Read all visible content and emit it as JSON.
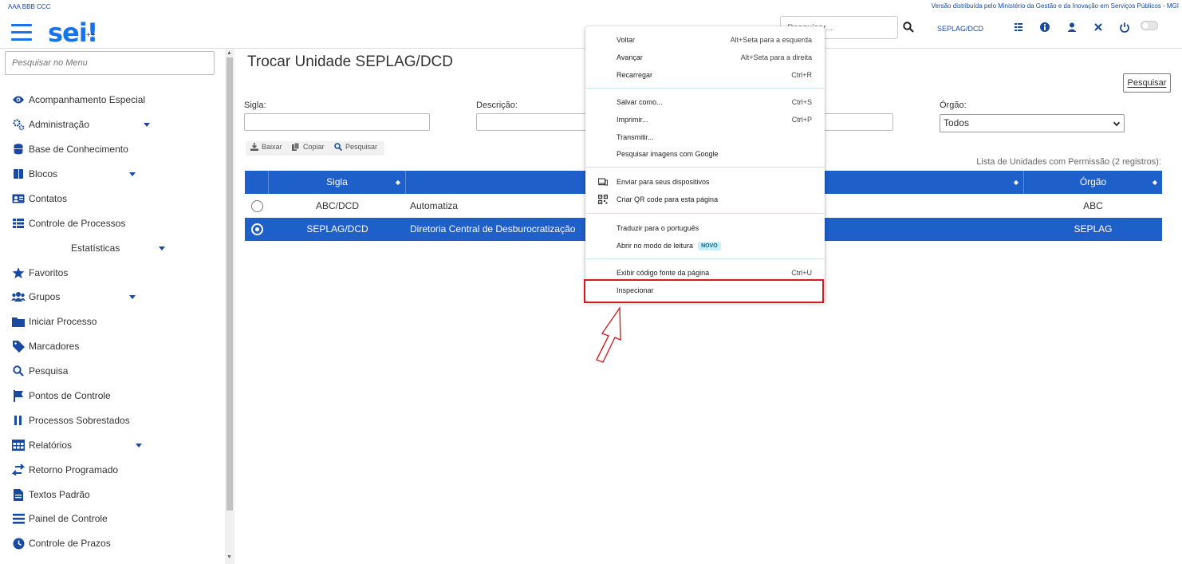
{
  "header": {
    "org": "AAA BBB CCC",
    "gov": "Versão distribuída pelo Ministério da Gestão e da Inovação em Serviços Públicos - MGI",
    "logo": "sei!",
    "logo_sub": "++",
    "search_placeholder": "Pesquisar...",
    "unit": "SEPLAG/DCD",
    "icons": [
      "grid-icon",
      "info-icon",
      "user-icon",
      "tools-icon",
      "power-icon",
      "theme-toggle"
    ]
  },
  "sidebar": {
    "search_placeholder": "Pesquisar no Menu",
    "items": [
      {
        "label": "Acompanhamento Especial",
        "icon": "eye-icon"
      },
      {
        "label": "Administração",
        "icon": "gears-icon",
        "expandable": true
      },
      {
        "label": "Base de Conhecimento",
        "icon": "database-icon"
      },
      {
        "label": "Blocos",
        "icon": "book-icon",
        "expandable": true
      },
      {
        "label": "Contatos",
        "icon": "contact-card-icon"
      },
      {
        "label": "Controle de Processos",
        "icon": "list-icon"
      },
      {
        "label": "Estatísticas",
        "icon": "",
        "expandable": true
      },
      {
        "label": "Favoritos",
        "icon": "star-icon"
      },
      {
        "label": "Grupos",
        "icon": "users-icon",
        "expandable": true
      },
      {
        "label": "Iniciar Processo",
        "icon": "folder-icon"
      },
      {
        "label": "Marcadores",
        "icon": "tag-icon"
      },
      {
        "label": "Pesquisa",
        "icon": "search-icon"
      },
      {
        "label": "Pontos de Controle",
        "icon": "flag-icon"
      },
      {
        "label": "Processos Sobrestados",
        "icon": "pause-icon"
      },
      {
        "label": "Relatórios",
        "icon": "table-icon",
        "expandable": true
      },
      {
        "label": "Retorno Programado",
        "icon": "exchange-icon"
      },
      {
        "label": "Textos Padrão",
        "icon": "file-icon"
      },
      {
        "label": "Painel de Controle",
        "icon": "bars-icon"
      },
      {
        "label": "Controle de Prazos",
        "icon": "clock-icon"
      }
    ]
  },
  "main": {
    "title": "Trocar Unidade SEPLAG/DCD",
    "search_button": "Pesquisar",
    "fields": {
      "sigla_label": "Sigla:",
      "descricao_label": "Descrição:",
      "orgao_label": "Órgão:",
      "orgao_value": "Todos"
    },
    "toolbar": {
      "baixar": "Baixar",
      "copiar": "Copiar",
      "pesquisar": "Pesquisar"
    },
    "list_caption": "Lista de Unidades com Permissão (2 registros):",
    "table": {
      "headers": [
        "Sigla",
        "",
        "Órgão"
      ],
      "rows": [
        {
          "sigla": "ABC/DCD",
          "descricao": "Automatiza",
          "orgao": "ABC",
          "selected": false
        },
        {
          "sigla": "SEPLAG/DCD",
          "descricao": "Diretoria Central de Desburocratização",
          "orgao": "SEPLAG",
          "selected": true
        }
      ]
    }
  },
  "context_menu": {
    "groups": [
      [
        {
          "label": "Voltar",
          "shortcut": "Alt+Seta para a esquerda"
        },
        {
          "label": "Avançar",
          "shortcut": "Alt+Seta para a direita"
        },
        {
          "label": "Recarregar",
          "shortcut": "Ctrl+R"
        }
      ],
      [
        {
          "label": "Salvar como...",
          "shortcut": "Ctrl+S"
        },
        {
          "label": "Imprimir...",
          "shortcut": "Ctrl+P"
        },
        {
          "label": "Transmitir...",
          "shortcut": ""
        },
        {
          "label": "Pesquisar imagens com Google",
          "shortcut": ""
        }
      ],
      [
        {
          "label": "Enviar para seus dispositivos",
          "shortcut": "",
          "icon": "devices-icon"
        },
        {
          "label": "Criar QR code para esta página",
          "shortcut": "",
          "icon": "qr-code-icon"
        }
      ],
      [
        {
          "label": "Traduzir para o português",
          "shortcut": ""
        },
        {
          "label": "Abrir no modo de leitura",
          "shortcut": "",
          "badge": "NOVO"
        }
      ],
      [
        {
          "label": "Exibir código fonte da página",
          "shortcut": "Ctrl+U"
        },
        {
          "label": "Inspecionar",
          "shortcut": ""
        }
      ]
    ]
  },
  "colors": {
    "accent": "#1f5fc9",
    "highlight": "#d71920"
  }
}
